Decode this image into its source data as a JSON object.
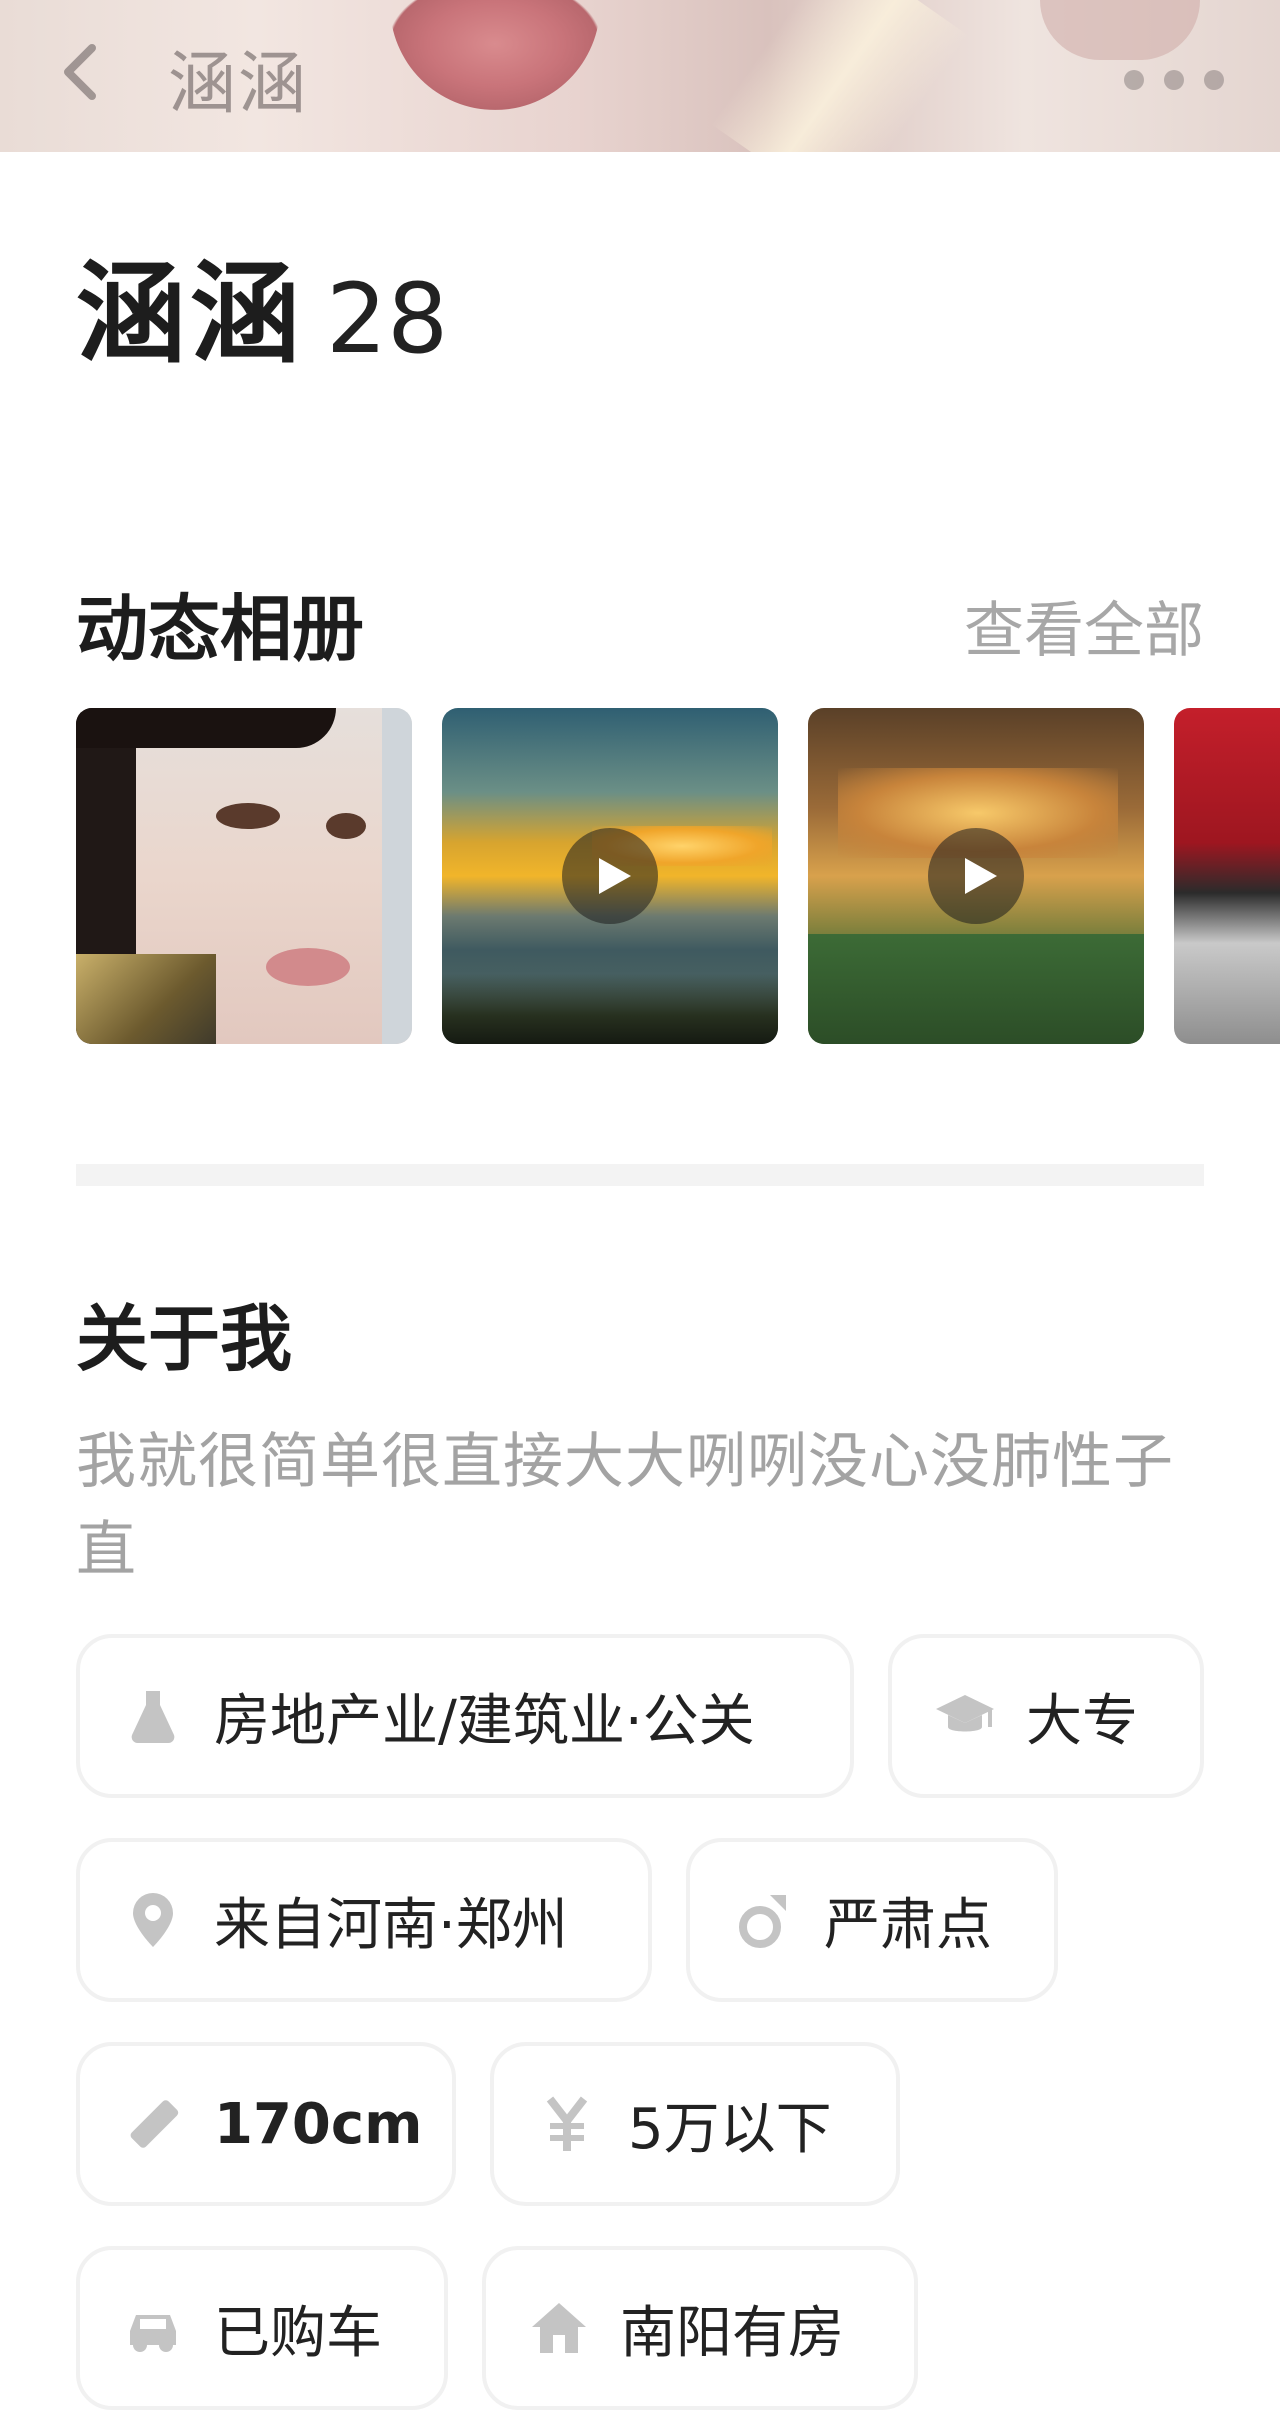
{
  "header": {
    "title": "涵涵",
    "back_icon": "chevron-left-icon",
    "more_icon": "more-dots-icon"
  },
  "profile": {
    "name": "涵涵",
    "age": "28"
  },
  "album": {
    "title": "动态相册",
    "see_all": "查看全部",
    "items": [
      {
        "kind": "photo",
        "desc": "portrait"
      },
      {
        "kind": "video",
        "desc": "sunset-sea",
        "play_icon": "play-icon"
      },
      {
        "kind": "video",
        "desc": "restaurant-interior",
        "play_icon": "play-icon"
      },
      {
        "kind": "photo",
        "desc": "red-scooter"
      }
    ]
  },
  "about": {
    "title": "关于我",
    "text": "我就很简单很直接大大咧咧没心没肺性子直"
  },
  "tags": [
    {
      "icon": "industry-icon",
      "label": "房地产业/建筑业·公关"
    },
    {
      "icon": "graduation-cap-icon",
      "label": "大专"
    },
    {
      "icon": "location-pin-icon",
      "label": "来自河南·郑州"
    },
    {
      "icon": "ring-icon",
      "label": "严肃点"
    },
    {
      "icon": "ruler-icon",
      "label": "170cm"
    },
    {
      "icon": "yen-icon",
      "label": "5万以下"
    },
    {
      "icon": "car-icon",
      "label": "已购车"
    },
    {
      "icon": "house-icon",
      "label": "南阳有房"
    }
  ],
  "colors": {
    "text_primary": "#1d1d1d",
    "text_secondary": "#a3a3a3",
    "icon_gray": "#c4c4c4",
    "tag_border": "#f1f1f1"
  }
}
